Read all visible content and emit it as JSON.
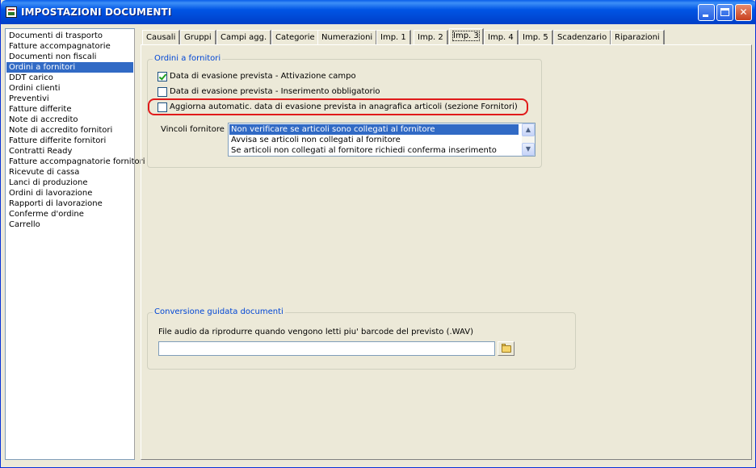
{
  "window": {
    "title": "IMPOSTAZIONI DOCUMENTI"
  },
  "left_list": {
    "items": [
      "Documenti di trasporto",
      "Fatture accompagnatorie",
      "Documenti non fiscali",
      "Ordini a fornitori",
      "DDT carico",
      "Ordini clienti",
      "Preventivi",
      "Fatture differite",
      "Note di accredito",
      "Note di accredito fornitori",
      "Fatture differite fornitori",
      "Contratti Ready",
      "Fatture accompagnatorie fornitori",
      "Ricevute di cassa",
      "Lanci di produzione",
      "Ordini di lavorazione",
      "Rapporti di lavorazione",
      "Conferme d'ordine",
      "Carrello"
    ],
    "selected": "Ordini a fornitori"
  },
  "tabs": [
    "Causali",
    "Gruppi",
    "Campi agg.",
    "Categorie",
    "Numerazioni",
    "Imp. 1",
    "Imp. 2",
    "Imp. 3",
    "Imp. 4",
    "Imp. 5",
    "Scadenzario",
    "Riparazioni"
  ],
  "active_tab": "Imp. 3",
  "group_ordini": {
    "legend": "Ordini a fornitori",
    "checkboxes": [
      {
        "label": "Data di evasione prevista - Attivazione campo",
        "checked": true
      },
      {
        "label": "Data di evasione prevista - Inserimento obbligatorio",
        "checked": false
      },
      {
        "label": "Aggiorna automatic. data di evasione prevista in anagrafica articoli (sezione Fornitori)",
        "checked": false
      }
    ],
    "vincoli_label": "Vincoli fornitore :",
    "vincoli_options": [
      "Non verificare se articoli sono collegati al fornitore",
      "Avvisa se articoli non collegati al fornitore",
      "Se articoli non collegati al fornitore richiedi conferma inserimento"
    ],
    "vincoli_selected": "Non verificare se articoli sono collegati al fornitore",
    "highlight_color": "#E01A1A"
  },
  "group_conversione": {
    "legend": "Conversione guidata documenti",
    "file_label": "File audio da riprodurre quando vengono letti piu' barcode del previsto  (.WAV)",
    "file_value": ""
  },
  "colors": {
    "selection": "#316AC5",
    "legend_text": "#0046D5",
    "window_bg": "#ECE9D8"
  }
}
